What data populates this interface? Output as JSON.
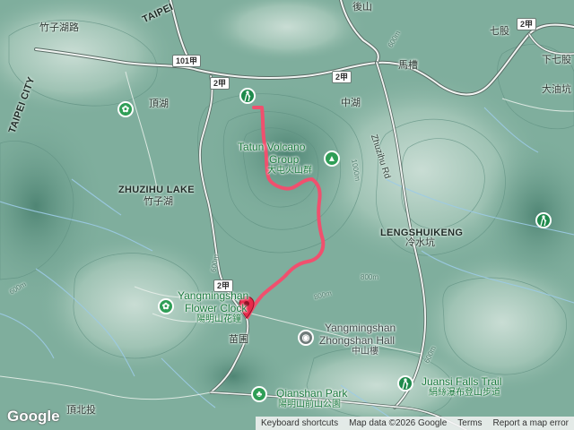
{
  "map": {
    "labels": {
      "zhuzihu_road": "竹子湖路",
      "taipei": "TAIPEI",
      "taipei_city": "TAIPEI CITY",
      "dinghu": "頂湖",
      "houshan": "後山",
      "qigu": "七股",
      "xia_qigu": "下七股",
      "daiyoukeng": "大油坑",
      "macao": "馬槽",
      "zhonghu": "中湖",
      "zhuzihu_road_en": "Zhuzihu Rd",
      "zhuzihu_lake_en": "ZHUZIHU LAKE",
      "zhuzihu_lake_zh": "竹子湖",
      "lengshuikeng_en": "LENGSHUIKENG",
      "lengshuikeng_zh": "冷水坑",
      "miaopu": "苗圃",
      "dingbeitou": "頂北投"
    },
    "shields": {
      "r101": "101甲",
      "r2a": "2甲",
      "r2b": "2甲",
      "r2c": "2甲",
      "r2d": "2甲"
    },
    "pois": {
      "tatun_en_1": "Tatun Volcano",
      "tatun_en_2": "Group",
      "tatun_zh": "大屯火山群",
      "flower_en_1": "Yangmingshan",
      "flower_en_2": "Flower Clock",
      "flower_zh": "陽明山花鐘",
      "zhongshan_en_1": "Yangmingshan",
      "zhongshan_en_2": "Zhongshan Hall",
      "zhongshan_zh": "中山樓",
      "qianshan_en": "Qianshan Park",
      "qianshan_zh": "陽明山前山公園",
      "juansi_en": "Juansi Falls Trail",
      "juansi_zh": "絹絲瀑布登山步道"
    },
    "contours": {
      "c1": "600m",
      "c2": "600m",
      "c3": "800m",
      "c4": "800m",
      "c5": "1000m",
      "c6": "600m",
      "c7": "600m"
    },
    "colors": {
      "route": "#f0506e",
      "road": "#ffffff",
      "water": "#9ccbe6",
      "terrain_base": "#7fae9d",
      "trail_start": "#1f8a4c",
      "trail_end": "#e8294a"
    },
    "icons": {
      "trail_start_pin": "hiking-icon",
      "trail_end_pin": "map-pin-icon",
      "park_pin": "flower-icon",
      "building_pin": "landmark-icon"
    }
  },
  "google_logo": "Google",
  "attribution": {
    "keyboard": "Keyboard shortcuts",
    "mapdata": "Map data ©2026 Google",
    "terms": "Terms",
    "report": "Report a map error"
  }
}
